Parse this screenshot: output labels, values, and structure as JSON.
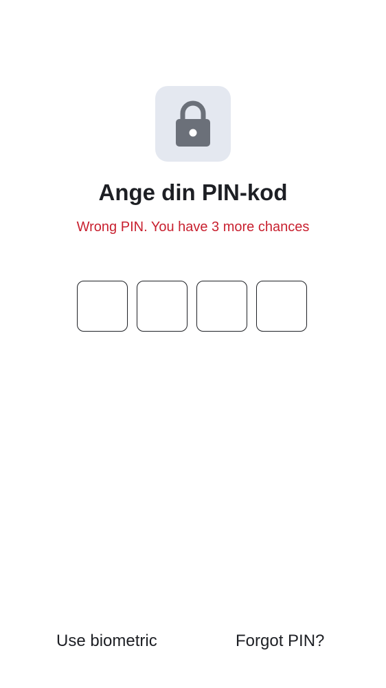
{
  "header": {
    "icon": "lock-icon",
    "title": "Ange din PIN-kod"
  },
  "error": {
    "message": "Wrong PIN. You have 3 more chances",
    "color": "#c8202f"
  },
  "pin": {
    "length": 4,
    "digits": [
      "",
      "",
      "",
      ""
    ]
  },
  "actions": {
    "biometric_label": "Use biometric",
    "forgot_label": "Forgot PIN?"
  },
  "colors": {
    "icon_tile_bg": "#e4e8f0",
    "icon_color": "#6b7079",
    "text": "#1d1f24"
  }
}
